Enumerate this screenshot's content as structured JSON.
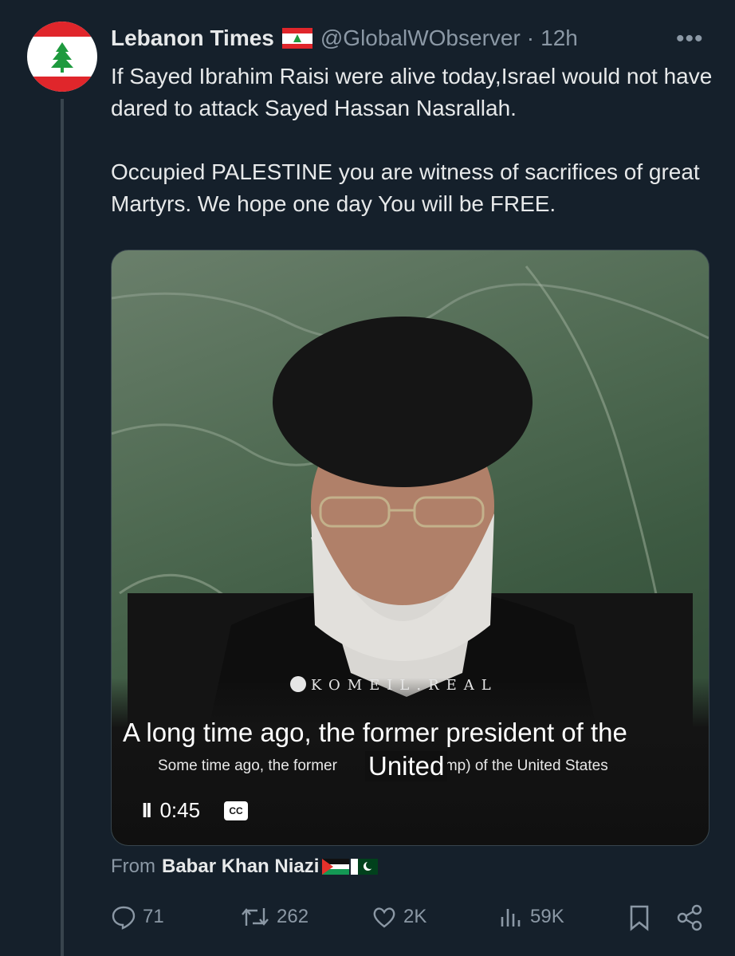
{
  "author": {
    "name": "Lebanon Times",
    "handle": "@GlobalWObserver",
    "separator": "·",
    "time": "12h"
  },
  "more_label": "•••",
  "tweet": {
    "paragraphs": [
      "If Sayed Ibrahim Raisi were alive today,Israel would not have dared to attack Sayed Hassan Nasrallah.",
      "Occupied PALESTINE you are witness of sacrifices of great Martyrs. We hope one day You will be FREE."
    ]
  },
  "video": {
    "watermark": "KOMEIL.REAL",
    "caption_main": "A long time ago, the former president of the",
    "caption_sub": "Some time ago, the former",
    "caption_sub_end": "rump) of the United States",
    "caption_overlay": "United",
    "time": "0:45",
    "pause_icon": "II",
    "cc_label": "CC"
  },
  "from": {
    "prefix": "From",
    "name": "Babar Khan Niazi"
  },
  "actions": {
    "replies": "71",
    "reposts": "262",
    "likes": "2K",
    "views": "59K"
  }
}
